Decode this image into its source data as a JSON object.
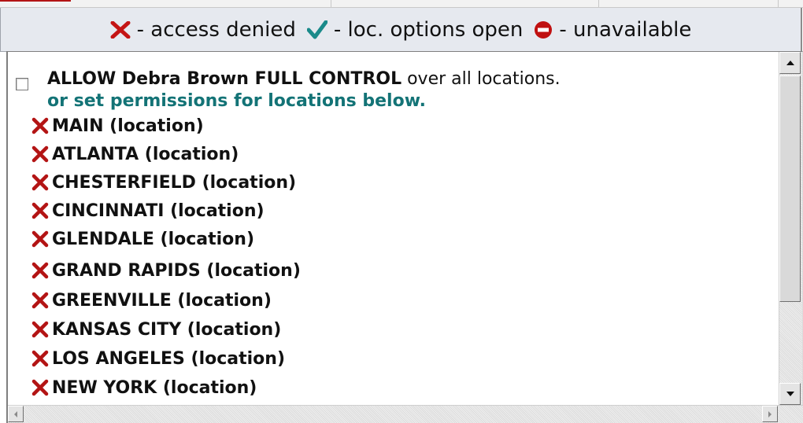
{
  "legend": {
    "items": [
      {
        "icon": "red-x-icon",
        "label": "- access denied"
      },
      {
        "icon": "check-icon",
        "label": "- loc. options open"
      },
      {
        "icon": "no-entry-icon",
        "label": "- unavailable"
      }
    ]
  },
  "permissions": {
    "allow_bold": "ALLOW Debra Brown FULL CONTROL",
    "allow_rest": "over all locations.",
    "set_text": "or set permissions for locations below.",
    "full_control_checked": false
  },
  "locations": [
    {
      "label": "MAIN (location)",
      "status": "access denied"
    },
    {
      "label": "ATLANTA (location)",
      "status": "access denied"
    },
    {
      "label": "CHESTERFIELD (location)",
      "status": "access denied"
    },
    {
      "label": "CINCINNATI (location)",
      "status": "access denied"
    },
    {
      "label": "GLENDALE (location)",
      "status": "access denied"
    },
    {
      "label": "GRAND RAPIDS (location)",
      "status": "access denied"
    },
    {
      "label": "GREENVILLE (location)",
      "status": "access denied"
    },
    {
      "label": "KANSAS CITY (location)",
      "status": "access denied"
    },
    {
      "label": "LOS ANGELES (location)",
      "status": "access denied"
    },
    {
      "label": "NEW YORK (location)",
      "status": "access denied"
    }
  ],
  "colors": {
    "denied_x": "#b31414",
    "check": "#1a8a8a",
    "no_entry": "#c01010",
    "subtitle": "#137376"
  }
}
